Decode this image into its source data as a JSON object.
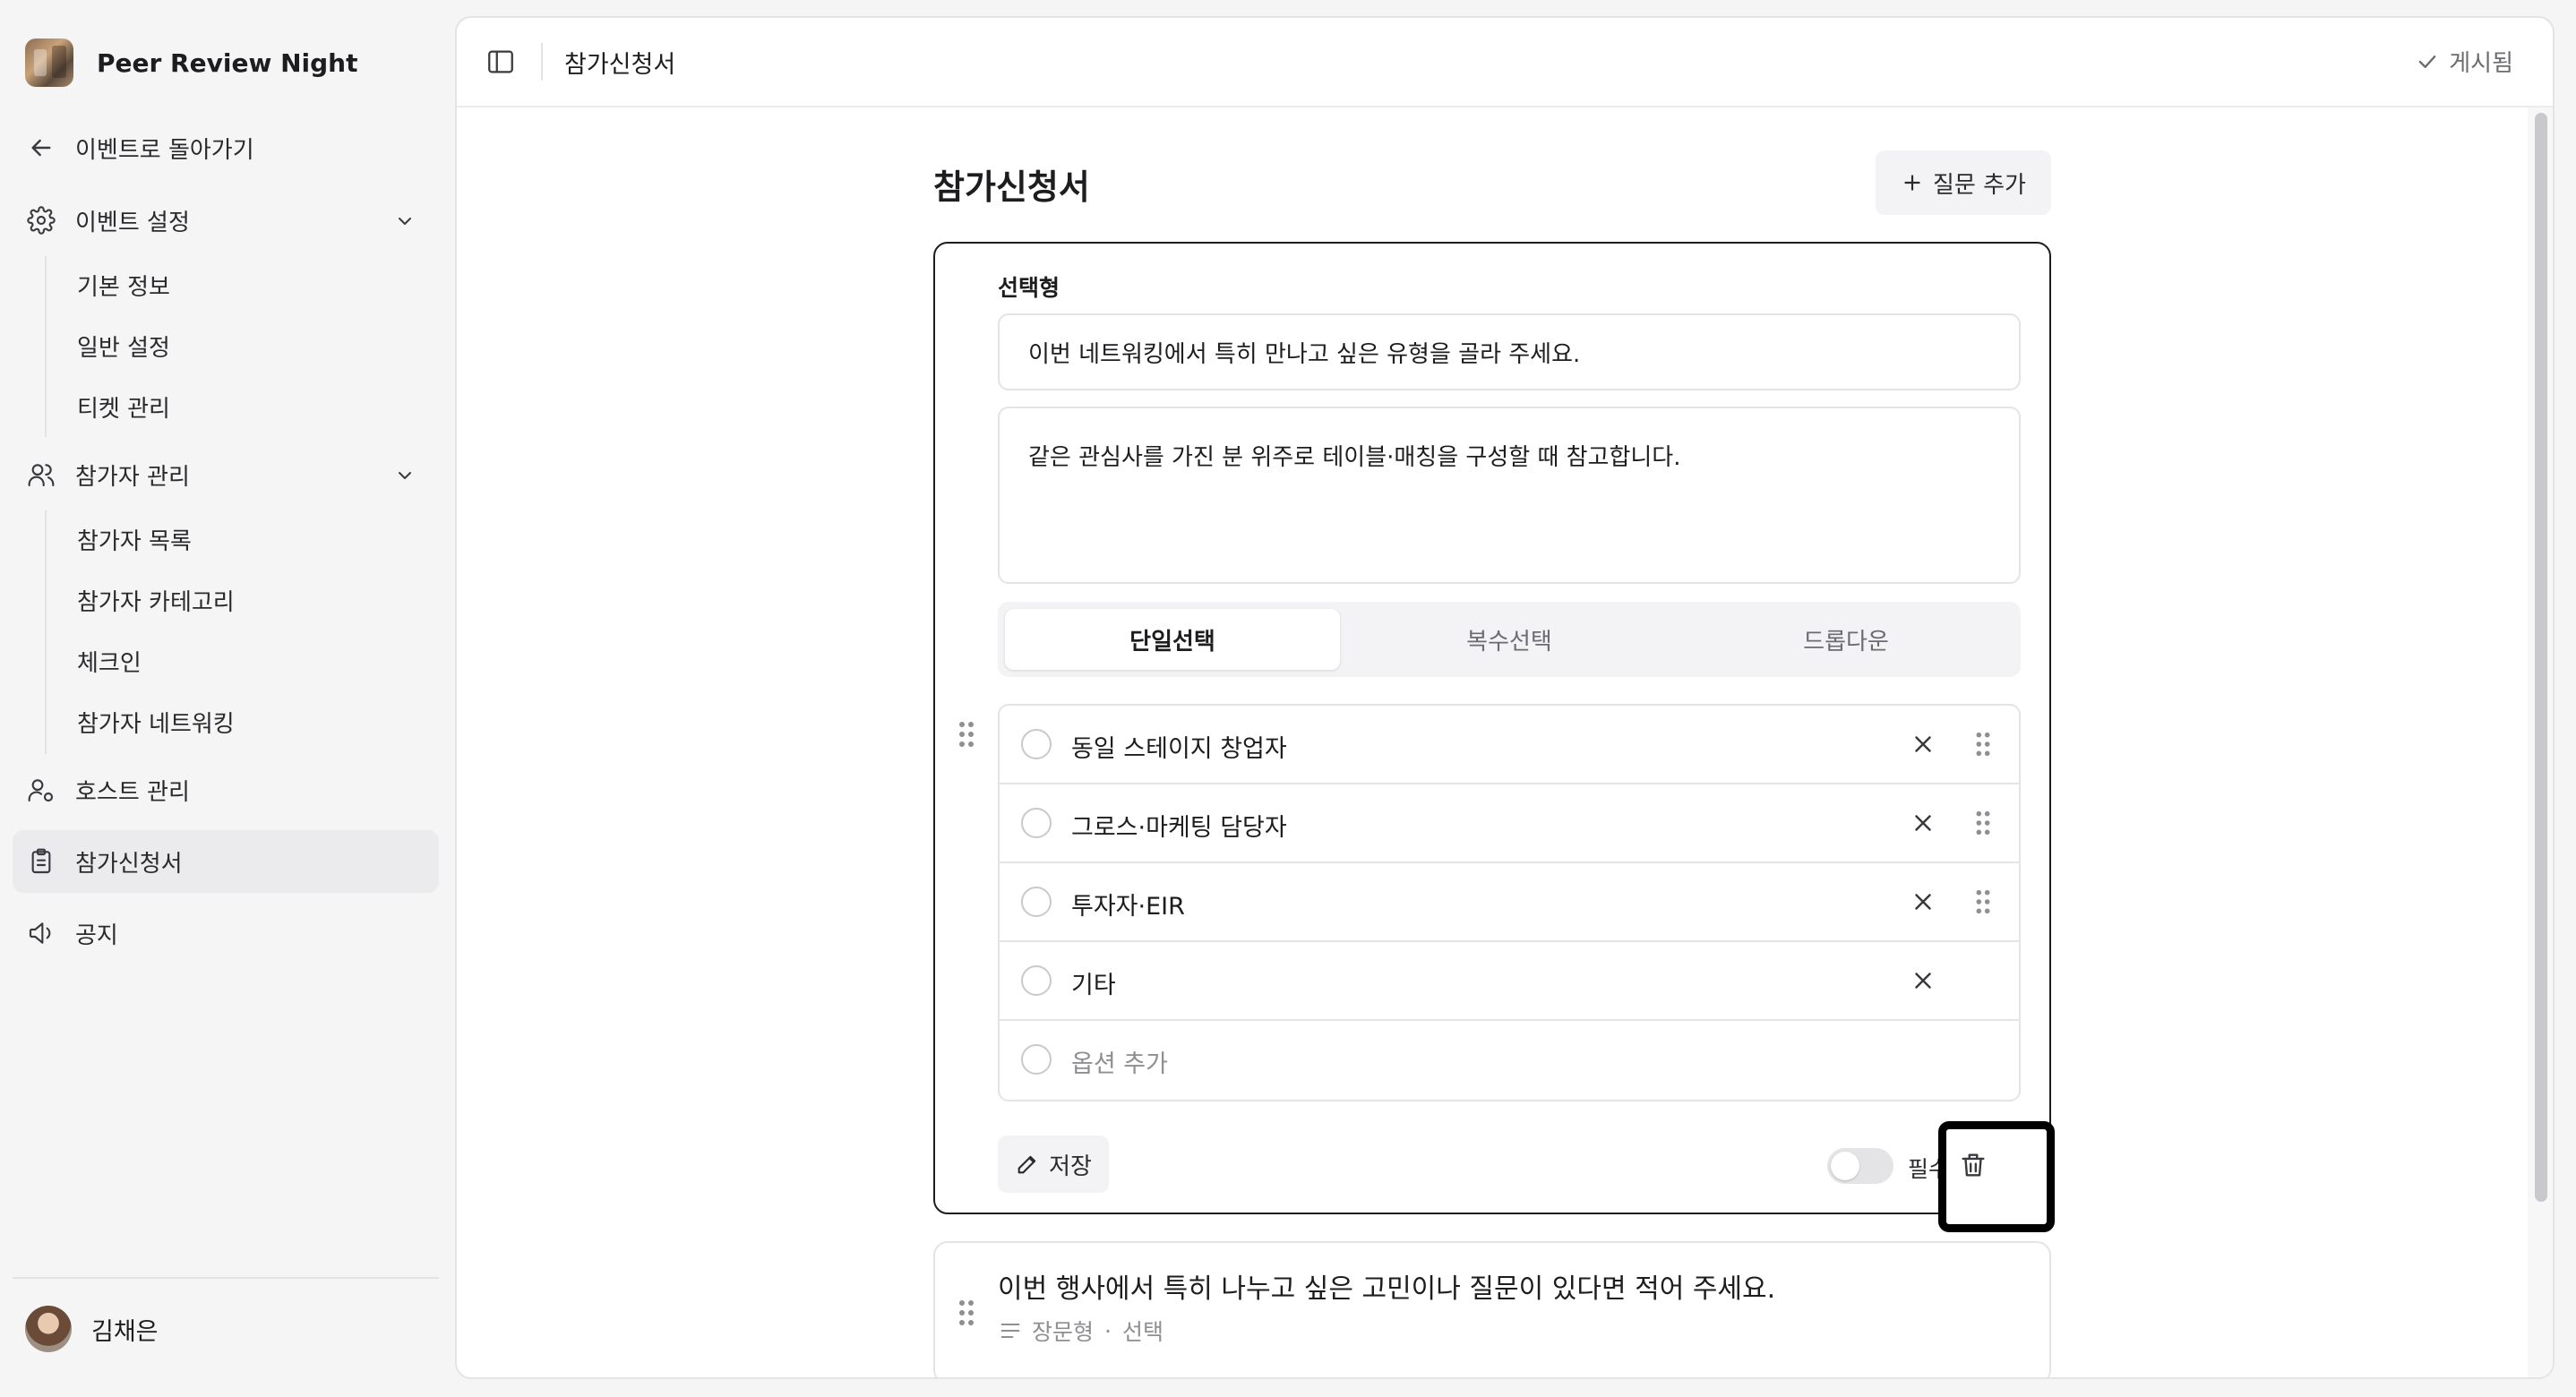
{
  "brand": {
    "name": "Peer Review Night"
  },
  "sidebar": {
    "back": "이벤트로 돌아가기",
    "event_settings": {
      "label": "이벤트 설정",
      "items": [
        "기본 정보",
        "일반 설정",
        "티켓 관리"
      ]
    },
    "attendees": {
      "label": "참가자 관리",
      "items": [
        "참가자 목록",
        "참가자 카테고리",
        "체크인",
        "참가자 네트워킹"
      ]
    },
    "hosts": "호스트 관리",
    "application": "참가신청서",
    "notice": "공지"
  },
  "user": {
    "name": "김채은"
  },
  "topbar": {
    "title": "참가신청서",
    "status": "게시됨"
  },
  "page": {
    "title": "참가신청서",
    "add_question": "질문 추가"
  },
  "question": {
    "type_label": "선택형",
    "title": "이번 네트워킹에서 특히 만나고 싶은 유형을 골라 주세요.",
    "description": "같은 관심사를 가진 분 위주로 테이블·매칭을 구성할 때 참고합니다.",
    "modes": [
      "단일선택",
      "복수선택",
      "드롭다운"
    ],
    "active_mode": "단일선택",
    "options": [
      "동일 스테이지 창업자",
      "그로스·마케팅 담당자",
      "투자자·EIR",
      "기타"
    ],
    "add_option": "옵션 추가",
    "save": "저장",
    "required_label": "필수"
  },
  "question2": {
    "title": "이번 행사에서 특히 나누고 싶은 고민이나 질문이 있다면 적어 주세요.",
    "type": "장문형",
    "requirement": "선택"
  }
}
